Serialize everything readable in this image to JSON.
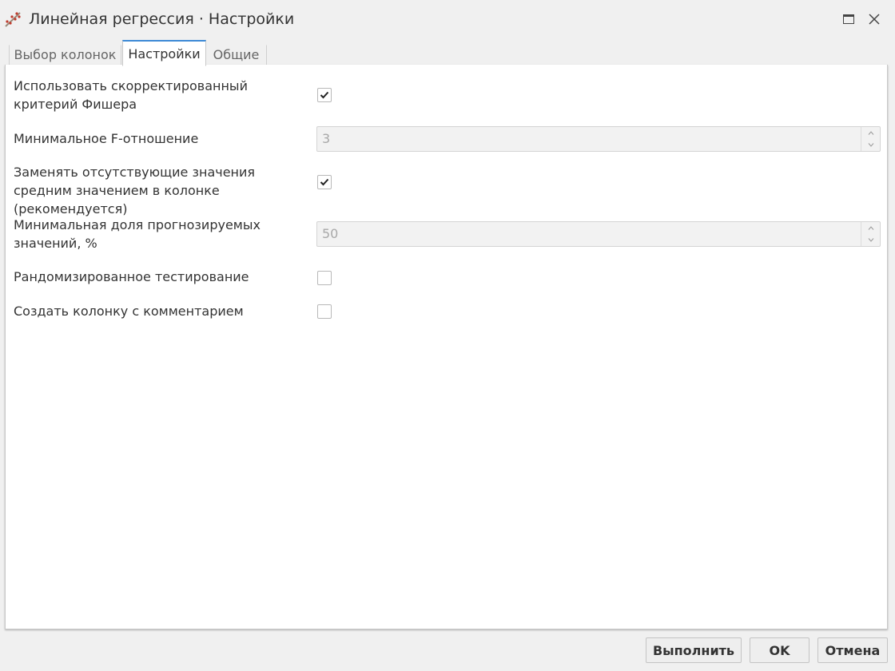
{
  "window": {
    "title": "Линейная регрессия · Настройки",
    "app_icon": "regression-tool-icon",
    "maximize_icon": "maximize-icon",
    "close_icon": "close-icon"
  },
  "tabs": [
    {
      "label": "Выбор колонок",
      "active": false
    },
    {
      "label": "Настройки",
      "active": true
    },
    {
      "label": "Общие",
      "active": false
    }
  ],
  "settings": {
    "adjusted_fisher": {
      "label": "Использовать скорректированный критерий Фишера",
      "checked": true
    },
    "min_f_ratio": {
      "label": "Минимальное F-отношение",
      "value": "3"
    },
    "replace_missing": {
      "label": "Заменять отсутствующие значения средним значением в колонке (рекомендуется)",
      "checked": true
    },
    "min_predicted_share": {
      "label": "Минимальная доля прогнозируемых значений, %",
      "value": "50"
    },
    "randomized_testing": {
      "label": "Рандомизированное тестирование",
      "checked": false
    },
    "comment_column": {
      "label": "Создать колонку с комментарием",
      "checked": false
    }
  },
  "buttons": {
    "run": "Выполнить",
    "ok": "OK",
    "cancel": "Отмена"
  },
  "colors": {
    "accent": "#3d8ad6",
    "panel_bg": "#ffffff",
    "window_bg": "#f0f0f0",
    "text": "#333333",
    "disabled_text": "#a8a8a8"
  }
}
